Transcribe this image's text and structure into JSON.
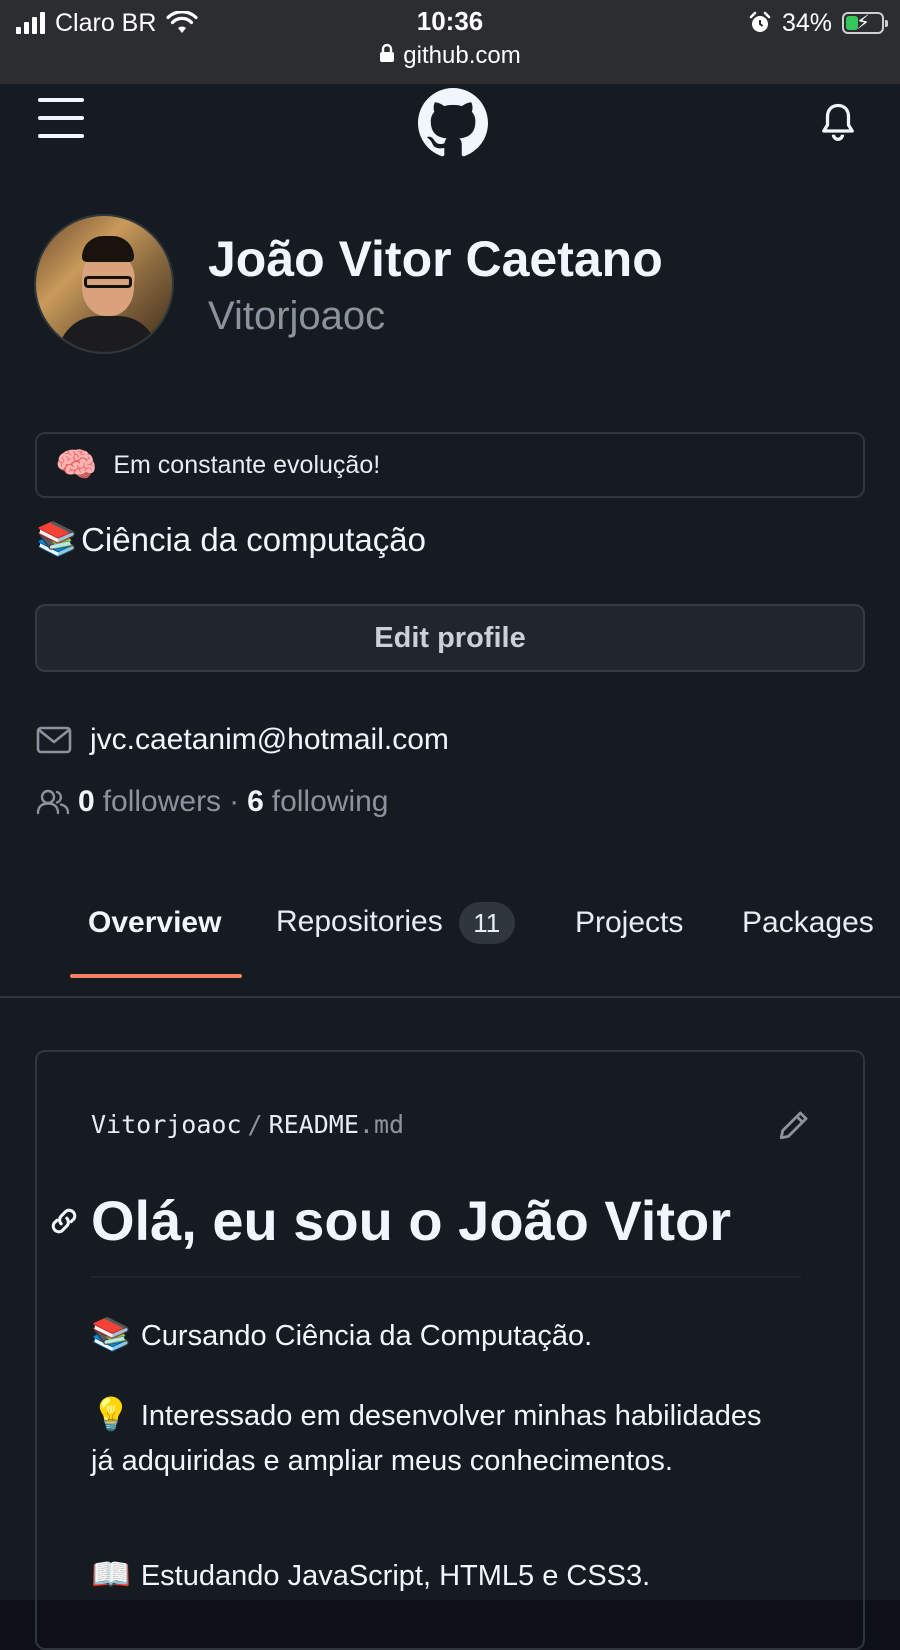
{
  "status_bar": {
    "carrier": "Claro BR",
    "time": "10:36",
    "battery_percent": "34%",
    "battery_level": 0.34,
    "url": "github.com"
  },
  "profile": {
    "name": "João Vitor Caetano",
    "login": "Vitorjoaoc",
    "status_emoji": "🧠",
    "status_text": "Em constante evolução!",
    "bio_emoji": "📚",
    "bio_text": "Ciência da computação",
    "edit_label": "Edit profile",
    "email": "jvc.caetanim@hotmail.com",
    "followers_count": "0",
    "followers_label": "followers",
    "separator": "·",
    "following_count": "6",
    "following_label": "following"
  },
  "tabs": [
    {
      "label": "Overview",
      "active": true
    },
    {
      "label": "Repositories",
      "count": "11"
    },
    {
      "label": "Projects"
    },
    {
      "label": "Packages"
    }
  ],
  "readme": {
    "owner": "Vitorjoaoc",
    "path_sep": "/",
    "file_base": "README",
    "file_ext": ".md",
    "heading": "Olá, eu sou o João Vitor",
    "paragraphs": [
      {
        "emoji": "📚",
        "text": "Cursando Ciência da Computação."
      },
      {
        "emoji": "💡",
        "text": "Interessado em desenvolver minhas habilidades já adquiridas e ampliar meus conhecimentos."
      },
      {
        "emoji": "📖",
        "text": "Estudando JavaScript, HTML5 e CSS3."
      }
    ]
  },
  "icons": {
    "menu": "hamburger-icon",
    "logo": "github-mark-icon",
    "notifications": "bell-icon",
    "email": "mail-icon",
    "people": "people-icon",
    "edit": "pencil-icon",
    "anchor": "link-icon",
    "lock": "lock-icon"
  },
  "colors": {
    "background": "#161b22",
    "text": "#f0f6fc",
    "muted": "#8b949e",
    "border": "#30363d",
    "tab_underline": "#f78166"
  }
}
